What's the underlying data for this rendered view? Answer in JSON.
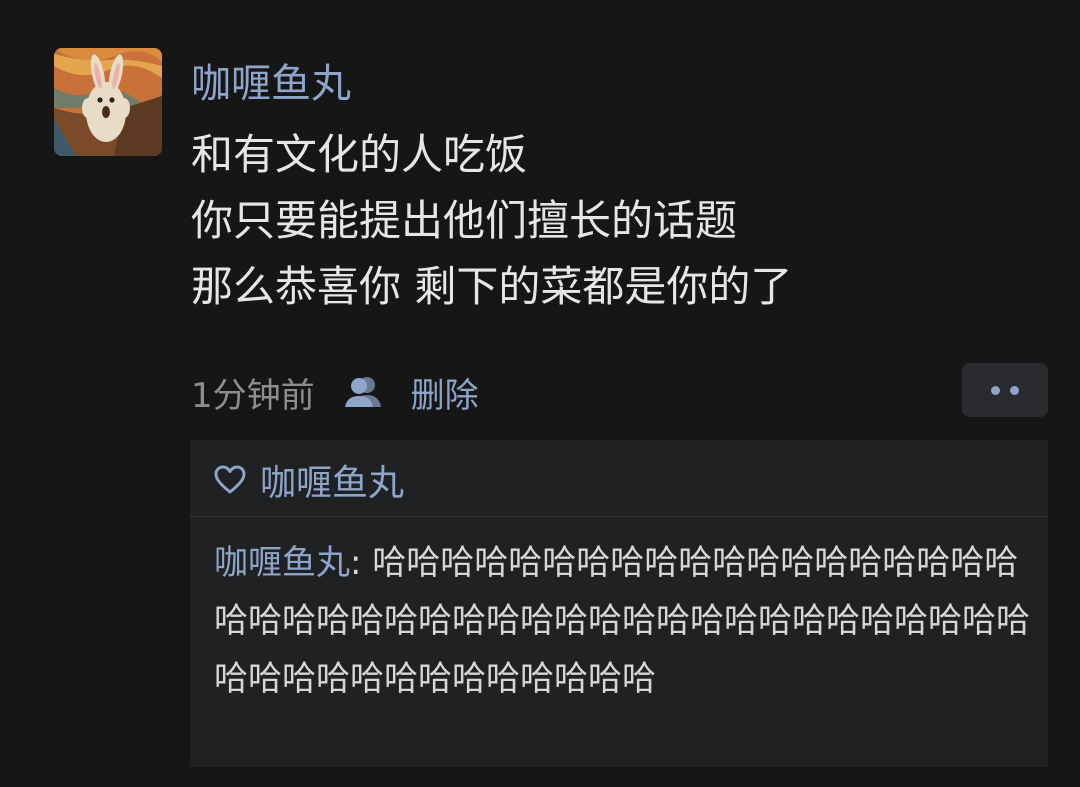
{
  "post": {
    "author": "咖喱鱼丸",
    "lines": [
      "和有文化的人吃饭",
      "你只要能提出他们擅长的话题",
      "那么恭喜你 剩下的菜都是你的了"
    ],
    "time": "1分钟前",
    "visibility_icon": "friends-icon",
    "delete_label": "删除",
    "more_icon": "more-dots-icon"
  },
  "likes": {
    "icon": "heart-outline-icon",
    "names": "咖喱鱼丸"
  },
  "comment": {
    "author": "咖喱鱼丸",
    "separator": ": ",
    "text": "哈哈哈哈哈哈哈哈哈哈哈哈哈哈哈哈哈哈哈哈哈哈哈哈哈哈哈哈哈哈哈哈哈哈哈哈哈哈哈哈哈哈哈哈哈哈哈哈哈哈哈哈哈哈哈哈"
  },
  "colors": {
    "background": "#161617",
    "accent": "#8ea4c8",
    "comment_box": "#202123",
    "text": "#e6e6e6",
    "muted": "#8d8d8d"
  }
}
